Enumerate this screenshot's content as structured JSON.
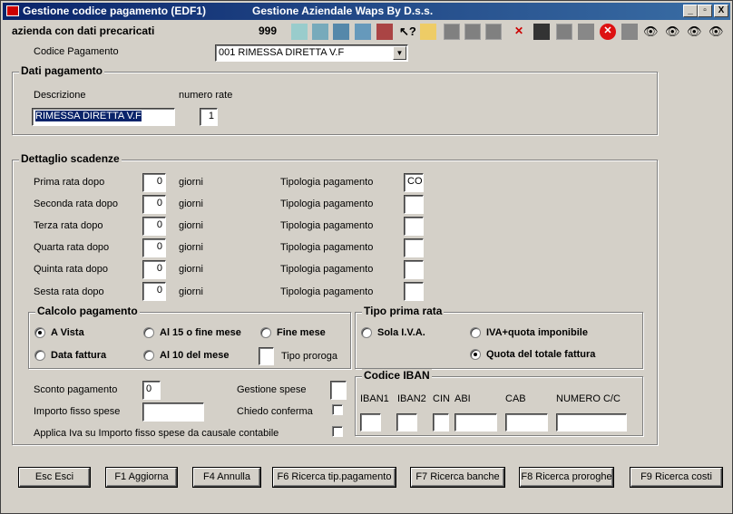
{
  "window": {
    "title": "Gestione codice pagamento (EDF1)",
    "app_title": "Gestione Aziendale Waps By D.s.s.",
    "controls": [
      "_",
      "▫",
      "X"
    ]
  },
  "header": {
    "company": "azienda con dati precaricati",
    "code": "999"
  },
  "toolbar_icons": [
    "calculator-icon",
    "eraser-icon",
    "tools-icon",
    "report-icon",
    "book-icon",
    "help-icon",
    "folder-icon",
    "disabled",
    "disabled",
    "disabled",
    "disabled",
    "delete-document-icon",
    "save-icon",
    "disabled",
    "list-icon",
    "close-icon",
    "list2-icon",
    "binoculars-icon",
    "binoculars-icon",
    "binoculars-icon",
    "binoculars-icon"
  ],
  "codice": {
    "label": "Codice Pagamento",
    "value": "001   RIMESSA DIRETTA V.F"
  },
  "dati": {
    "title": "Dati pagamento",
    "descr_label": "Descrizione",
    "rate_label": "numero rate",
    "descr_value": "RIMESSA DIRETTA V.F",
    "rate_value": "1"
  },
  "dettaglio": {
    "title": "Dettaglio scadenze",
    "giorni": "giorni",
    "tipologia": "Tipologia pagamento",
    "rows": [
      {
        "label": "Prima rata dopo",
        "days": "0",
        "tipo": "CO"
      },
      {
        "label": "Seconda rata dopo",
        "days": "0",
        "tipo": ""
      },
      {
        "label": "Terza rata dopo",
        "days": "0",
        "tipo": ""
      },
      {
        "label": "Quarta rata dopo",
        "days": "0",
        "tipo": ""
      },
      {
        "label": "Quinta rata dopo",
        "days": "0",
        "tipo": ""
      },
      {
        "label": "Sesta rata dopo",
        "days": "0",
        "tipo": ""
      }
    ]
  },
  "calcolo": {
    "title": "Calcolo pagamento",
    "opt_vista": "A Vista",
    "opt_15": "Al 15 o fine mese",
    "opt_fine": "Fine mese",
    "opt_data": "Data fattura",
    "opt_10": "Al 10 del mese",
    "proroga_label": "Tipo proroga",
    "selected": "A Vista"
  },
  "prima": {
    "title": "Tipo prima rata",
    "opt_iva": "Sola I.V.A.",
    "opt_ivaquota": "IVA+quota imponibile",
    "opt_totale": "Quota del totale fattura",
    "selected": "Quota del totale fattura"
  },
  "spese": {
    "sconto_label": "Sconto pagamento",
    "sconto_value": "0",
    "importo_label": "Importo fisso spese",
    "gestione_label": "Gestione spese",
    "chiedo_label": "Chiedo conferma",
    "applica_label": "Applica Iva su Importo fisso spese da causale contabile"
  },
  "iban": {
    "title": "Codice IBAN",
    "cols": [
      "IBAN1",
      "IBAN2",
      "CIN",
      "ABI",
      "CAB",
      "NUMERO C/C"
    ]
  },
  "buttons": [
    "Esc Esci",
    "F1 Aggiorna",
    "F4 Annulla",
    "F6 Ricerca tip.pagamento",
    "F7 Ricerca banche",
    "F8 Ricerca proroghe",
    "F9 Ricerca costi"
  ]
}
